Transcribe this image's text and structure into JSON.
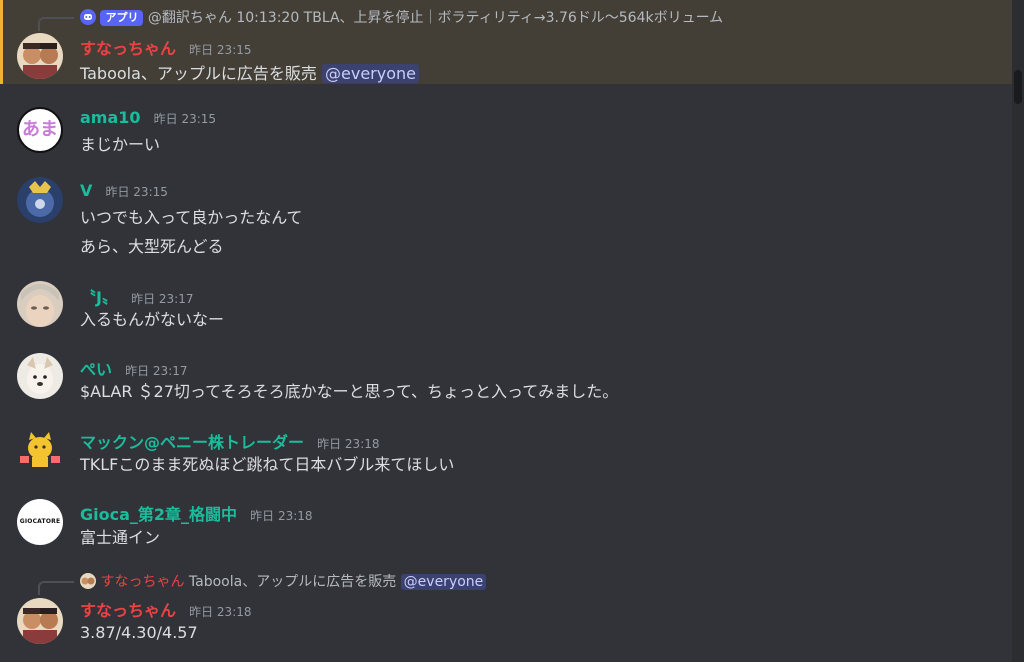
{
  "colors": {
    "background": "#313338",
    "highlight_background": "#433f36",
    "highlight_bar": "#f0b232",
    "mention_bg": "#3c4270",
    "mention_fg": "#c9cdfb",
    "timestamp": "#949ba4",
    "name_red": "#ed4245",
    "name_teal": "#1abc9c"
  },
  "messages": [
    {
      "reply": {
        "icon": "discord-icon",
        "app_tag": "アプリ",
        "author": "@翻訳ちゃん",
        "text": "10:13:20 TBLA、上昇を停止｜ボラティリティ→3.76ドル〜564kボリューム"
      },
      "author": "すなっちゃん",
      "time": "昨日 23:15",
      "lines": [
        "Taboola、アップルに広告を販売"
      ],
      "mention": "@everyone"
    },
    {
      "author": "ama10",
      "time": "昨日 23:15",
      "lines": [
        "まじかーい"
      ],
      "avatar_text": "あま"
    },
    {
      "author": "V",
      "time": "昨日 23:15",
      "lines": [
        "いつでも入って良かったなんて",
        "あら、大型死んどる"
      ]
    },
    {
      "author": "〝J〟",
      "time": "昨日 23:17",
      "lines": [
        "入るもんがないなー"
      ]
    },
    {
      "author": "ぺい",
      "time": "昨日 23:17",
      "lines": [
        "$ALAR ＄27切ってそろそろ底かなーと思って、ちょっと入ってみました。"
      ]
    },
    {
      "author": "マックン@ペニー株トレーダー",
      "time": "昨日 23:18",
      "lines": [
        "TKLFこのまま死ぬほど跳ねて日本バブル来てほしい"
      ]
    },
    {
      "author": "Gioca_第2章_格闘中",
      "time": "昨日 23:18",
      "lines": [
        "富士通イン"
      ],
      "avatar_text": "GIOCATORE"
    },
    {
      "reply": {
        "author": "すなっちゃん",
        "text": "Taboola、アップルに広告を販売",
        "mention": "@everyone"
      },
      "author": "すなっちゃん",
      "time": "昨日 23:18",
      "lines": [
        "3.87/4.30/4.57"
      ]
    }
  ]
}
